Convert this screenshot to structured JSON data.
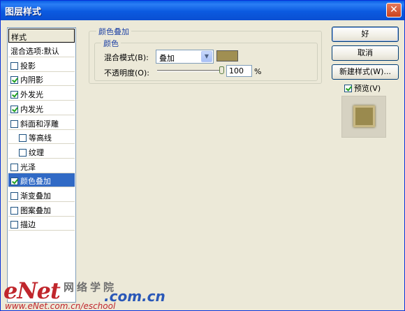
{
  "window": {
    "title": "图层样式",
    "close_glyph": "✕"
  },
  "styles_panel": {
    "header": "样式",
    "items": [
      {
        "label": "混合选项:默认",
        "has_checkbox": false,
        "checked": false,
        "selected": false
      },
      {
        "label": "投影",
        "has_checkbox": true,
        "checked": false,
        "selected": false
      },
      {
        "label": "内阴影",
        "has_checkbox": true,
        "checked": true,
        "selected": false
      },
      {
        "label": "外发光",
        "has_checkbox": true,
        "checked": true,
        "selected": false
      },
      {
        "label": "内发光",
        "has_checkbox": true,
        "checked": true,
        "selected": false
      },
      {
        "label": "斜面和浮雕",
        "has_checkbox": true,
        "checked": false,
        "selected": false
      },
      {
        "label": "等高线",
        "has_checkbox": true,
        "checked": false,
        "selected": false,
        "indent": true
      },
      {
        "label": "纹理",
        "has_checkbox": true,
        "checked": false,
        "selected": false,
        "indent": true
      },
      {
        "label": "光泽",
        "has_checkbox": true,
        "checked": false,
        "selected": false
      },
      {
        "label": "颜色叠加",
        "has_checkbox": true,
        "checked": true,
        "selected": true
      },
      {
        "label": "渐变叠加",
        "has_checkbox": true,
        "checked": false,
        "selected": false
      },
      {
        "label": "图案叠加",
        "has_checkbox": true,
        "checked": false,
        "selected": false
      },
      {
        "label": "描边",
        "has_checkbox": true,
        "checked": false,
        "selected": false
      }
    ]
  },
  "color_overlay": {
    "group_title": "颜色叠加",
    "subgroup_title": "颜色",
    "blend_mode_label": "混合模式(B):",
    "blend_mode_value": "叠加",
    "overlay_color": "#a08f52",
    "opacity_label": "不透明度(O):",
    "opacity_value": "100",
    "opacity_unit": "%",
    "opacity_level": 1.0
  },
  "buttons": {
    "ok": "好",
    "cancel": "取消",
    "new_style": "新建样式(W)..."
  },
  "preview": {
    "label": "预览(V)",
    "checked": true
  },
  "watermark": {
    "logo": "eNet",
    "cn": "网络学院",
    "com": ".com.cn",
    "url": "www.eNet.com.cn/eschool"
  },
  "colors": {
    "title_bar": "#0a5fe6",
    "selection": "#316ac5",
    "dialog_bg": "#ece9d8"
  }
}
